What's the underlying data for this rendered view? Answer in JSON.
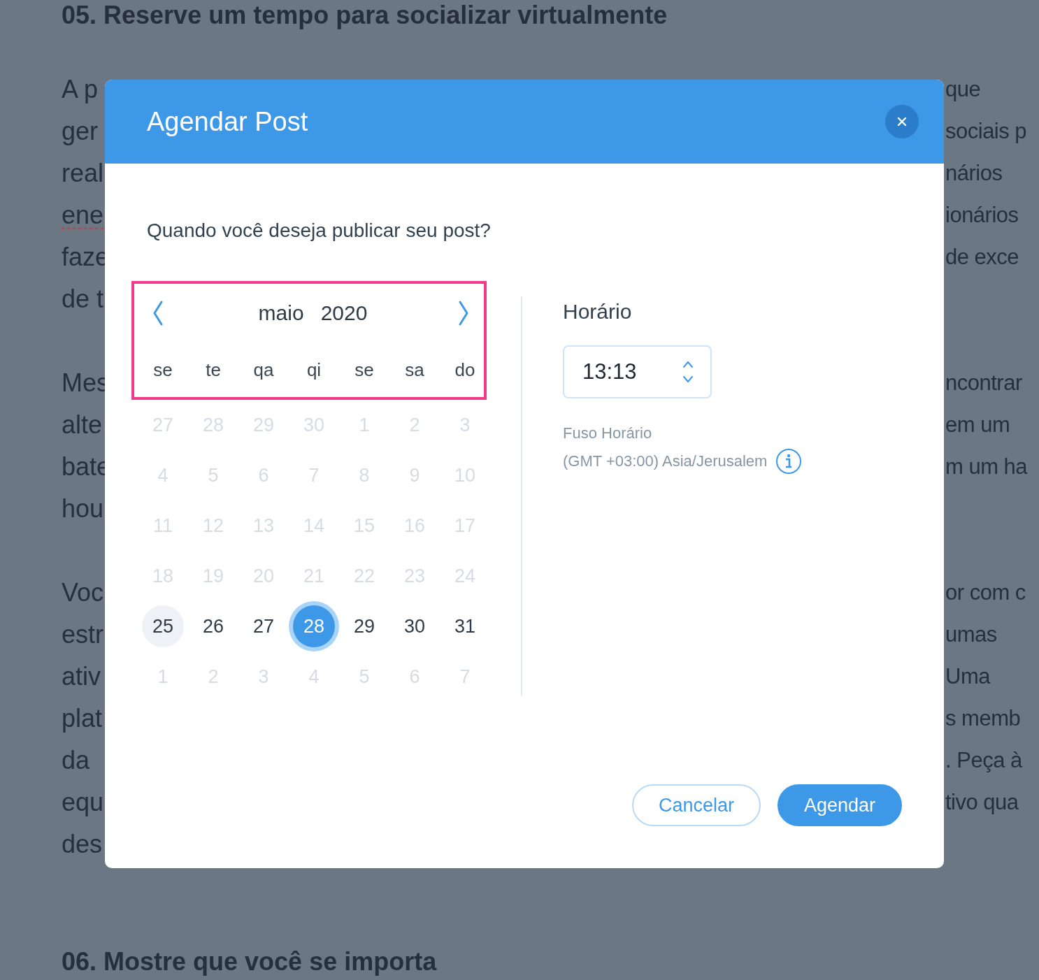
{
  "background": {
    "heading_top": "05. Reserve um tempo para socializar virtualmente",
    "paragraphs": [
      {
        "lines": [
          {
            "left": "A p",
            "right": "que",
            "misspelled": false
          },
          {
            "left": "ger",
            "right": "sociais p",
            "misspelled": false
          },
          {
            "left": "real",
            "right": "nários",
            "misspelled": false
          },
          {
            "left": "ene",
            "right": "ionários",
            "misspelled": true
          },
          {
            "left": "faze",
            "right": "de exce",
            "misspelled": false
          },
          {
            "left": "de t",
            "misspelled": false
          }
        ]
      },
      {
        "lines": [
          {
            "left": "Mes",
            "right": "ncontrar",
            "misspelled": false
          },
          {
            "left": "alte",
            "right": "em um",
            "misspelled": false
          },
          {
            "left": "bate",
            "right": "m um ha",
            "misspelled": false
          },
          {
            "left": "hou",
            "misspelled": false
          }
        ]
      },
      {
        "lines": [
          {
            "left": "Voc",
            "right": "or com c",
            "misspelled": false
          },
          {
            "left": "estr",
            "right": "umas",
            "misspelled": false
          },
          {
            "left": "ativ",
            "right": "Uma",
            "misspelled": false
          },
          {
            "left": "plat",
            "right": "s memb",
            "misspelled": false
          },
          {
            "left": "da",
            "right": ". Peça à",
            "misspelled": false
          },
          {
            "left": "equ",
            "right": "tivo qua",
            "misspelled": false
          },
          {
            "left": "des",
            "misspelled": false
          }
        ]
      }
    ],
    "heading_bottom": "06. Mostre que você se importa"
  },
  "dialog": {
    "title": "Agendar Post",
    "question": "Quando você deseja publicar seu post?",
    "calendar": {
      "month": "maio",
      "year": "2020",
      "weekdays": [
        "se",
        "te",
        "qa",
        "qi",
        "se",
        "sa",
        "do"
      ],
      "weeks": [
        [
          {
            "day": "27",
            "disabled": true,
            "today": false,
            "selected": false
          },
          {
            "day": "28",
            "disabled": true,
            "today": false,
            "selected": false
          },
          {
            "day": "29",
            "disabled": true,
            "today": false,
            "selected": false
          },
          {
            "day": "30",
            "disabled": true,
            "today": false,
            "selected": false
          },
          {
            "day": "1",
            "disabled": true,
            "today": false,
            "selected": false
          },
          {
            "day": "2",
            "disabled": true,
            "today": false,
            "selected": false
          },
          {
            "day": "3",
            "disabled": true,
            "today": false,
            "selected": false
          }
        ],
        [
          {
            "day": "4",
            "disabled": true,
            "today": false,
            "selected": false
          },
          {
            "day": "5",
            "disabled": true,
            "today": false,
            "selected": false
          },
          {
            "day": "6",
            "disabled": true,
            "today": false,
            "selected": false
          },
          {
            "day": "7",
            "disabled": true,
            "today": false,
            "selected": false
          },
          {
            "day": "8",
            "disabled": true,
            "today": false,
            "selected": false
          },
          {
            "day": "9",
            "disabled": true,
            "today": false,
            "selected": false
          },
          {
            "day": "10",
            "disabled": true,
            "today": false,
            "selected": false
          }
        ],
        [
          {
            "day": "11",
            "disabled": true,
            "today": false,
            "selected": false
          },
          {
            "day": "12",
            "disabled": true,
            "today": false,
            "selected": false
          },
          {
            "day": "13",
            "disabled": true,
            "today": false,
            "selected": false
          },
          {
            "day": "14",
            "disabled": true,
            "today": false,
            "selected": false
          },
          {
            "day": "15",
            "disabled": true,
            "today": false,
            "selected": false
          },
          {
            "day": "16",
            "disabled": true,
            "today": false,
            "selected": false
          },
          {
            "day": "17",
            "disabled": true,
            "today": false,
            "selected": false
          }
        ],
        [
          {
            "day": "18",
            "disabled": true,
            "today": false,
            "selected": false
          },
          {
            "day": "19",
            "disabled": true,
            "today": false,
            "selected": false
          },
          {
            "day": "20",
            "disabled": true,
            "today": false,
            "selected": false
          },
          {
            "day": "21",
            "disabled": true,
            "today": false,
            "selected": false
          },
          {
            "day": "22",
            "disabled": true,
            "today": false,
            "selected": false
          },
          {
            "day": "23",
            "disabled": true,
            "today": false,
            "selected": false
          },
          {
            "day": "24",
            "disabled": true,
            "today": false,
            "selected": false
          }
        ],
        [
          {
            "day": "25",
            "disabled": false,
            "today": true,
            "selected": false
          },
          {
            "day": "26",
            "disabled": false,
            "today": false,
            "selected": false
          },
          {
            "day": "27",
            "disabled": false,
            "today": false,
            "selected": false
          },
          {
            "day": "28",
            "disabled": false,
            "today": false,
            "selected": true
          },
          {
            "day": "29",
            "disabled": false,
            "today": false,
            "selected": false
          },
          {
            "day": "30",
            "disabled": false,
            "today": false,
            "selected": false
          },
          {
            "day": "31",
            "disabled": false,
            "today": false,
            "selected": false
          }
        ],
        [
          {
            "day": "1",
            "disabled": true,
            "today": false,
            "selected": false
          },
          {
            "day": "2",
            "disabled": true,
            "today": false,
            "selected": false
          },
          {
            "day": "3",
            "disabled": true,
            "today": false,
            "selected": false
          },
          {
            "day": "4",
            "disabled": true,
            "today": false,
            "selected": false
          },
          {
            "day": "5",
            "disabled": true,
            "today": false,
            "selected": false
          },
          {
            "day": "6",
            "disabled": true,
            "today": false,
            "selected": false
          },
          {
            "day": "7",
            "disabled": true,
            "today": false,
            "selected": false
          }
        ]
      ]
    },
    "time": {
      "label": "Horário",
      "value": "13:13"
    },
    "timezone": {
      "label": "Fuso Horário",
      "value": "(GMT +03:00) Asia/Jerusalem"
    },
    "buttons": [
      {
        "label": "Cancelar",
        "kind": "secondary"
      },
      {
        "label": "Agendar",
        "kind": "primary"
      }
    ]
  }
}
